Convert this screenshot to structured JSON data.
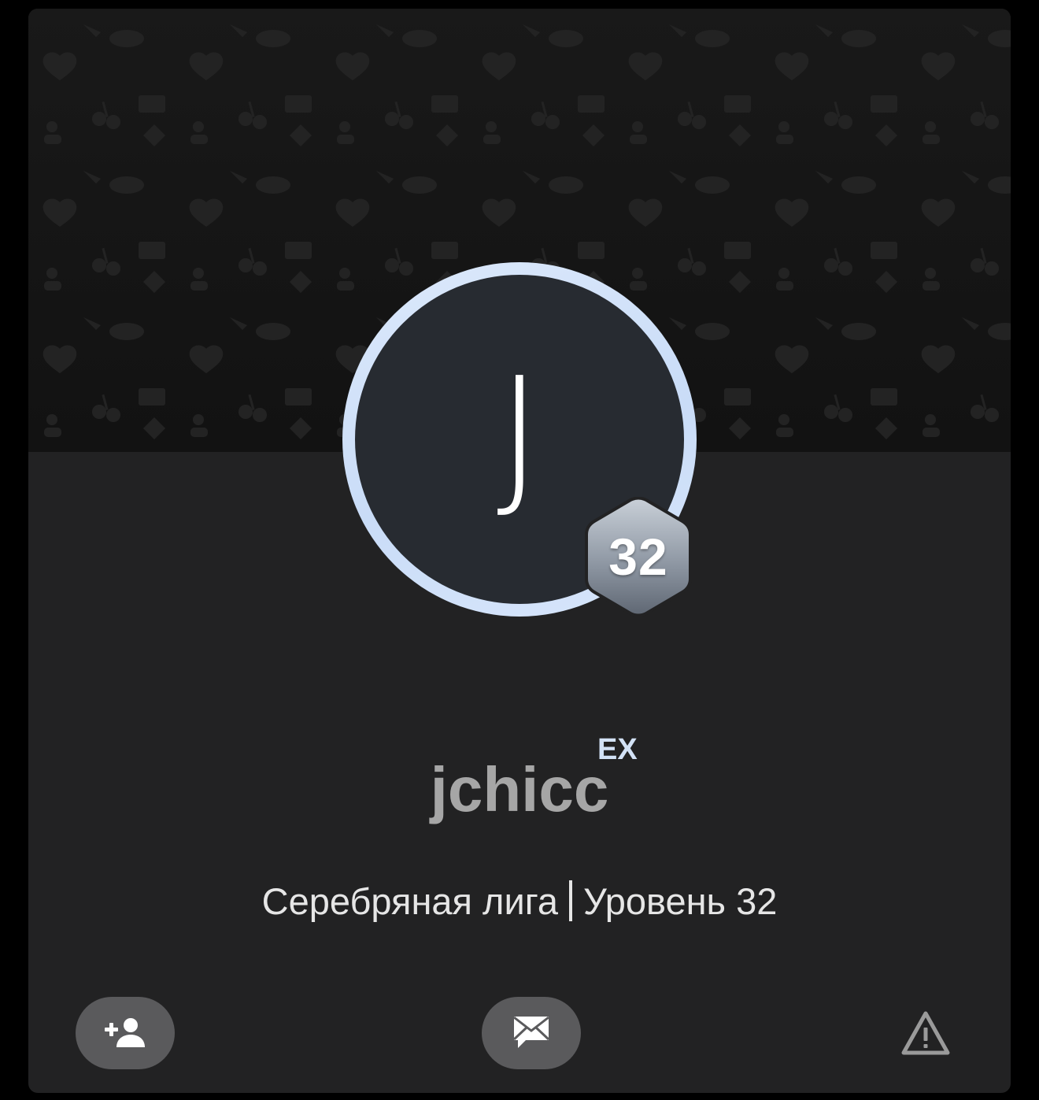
{
  "profile": {
    "avatar_letter": "J",
    "level_badge": "32",
    "username": "jchicc",
    "tag": "EX",
    "league": "Серебряная лига",
    "level_text": "Уровень 32"
  },
  "colors": {
    "card_background": "#222223",
    "banner_background": "#141414",
    "avatar_ring": "#d0e1f9",
    "avatar_fill": "#272b31",
    "username": "#a6a6a6",
    "tag": "#d3e2f6",
    "button_background": "#5a5a5c"
  },
  "actions": {
    "add_friend_icon": "person-add-icon",
    "message_icon": "envelope-icon",
    "report_icon": "warning-triangle-icon"
  }
}
